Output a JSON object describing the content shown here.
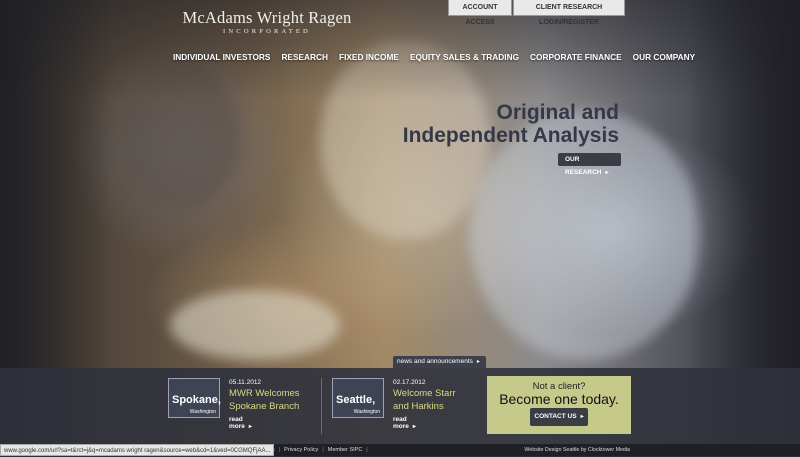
{
  "header": {
    "logo_name": "McAdams Wright Ragen",
    "logo_sub": "INCORPORATED",
    "account_access": "ACCOUNT ACCESS",
    "client_research": "CLIENT RESEARCH LOGIN/REGISTER"
  },
  "nav": {
    "items": [
      "INDIVIDUAL INVESTORS",
      "RESEARCH",
      "FIXED INCOME",
      "EQUITY SALES & TRADING",
      "CORPORATE FINANCE",
      "OUR COMPANY"
    ]
  },
  "hero": {
    "line1": "Original and",
    "line2": "Independent Analysis",
    "cta_label": "OUR RESEARCH",
    "arrow": "▸"
  },
  "news": {
    "tab_label": "news and announcements",
    "tab_arrow": "▸",
    "items": [
      {
        "city": "Spokane,",
        "state": "Washington",
        "date": "05.11.2012",
        "title": "MWR Welcomes Spokane Branch",
        "more": "read more"
      },
      {
        "city": "Seattle,",
        "state": "Washington",
        "date": "02.17.2012",
        "title": "Welcome Starr and Harkins",
        "more": "read more"
      }
    ]
  },
  "promo": {
    "question": "Not a client?",
    "headline": "Become one today.",
    "contact_label": "CONTACT US"
  },
  "footer": {
    "status_url": "www.google.com/url?sa=t&rct=j&q=mcadams wright ragen&source=web&cd=1&ved=0CGMQFjAA...",
    "partial_link": "res",
    "privacy": "Privacy Policy",
    "member": "Member SIPC",
    "credit": "Website Design Seattle by Clocktower Media"
  },
  "colors": {
    "headline": "#353848",
    "promo_bg": "#c5c98a",
    "news_title": "#d8d88a",
    "band": "#30323c"
  }
}
